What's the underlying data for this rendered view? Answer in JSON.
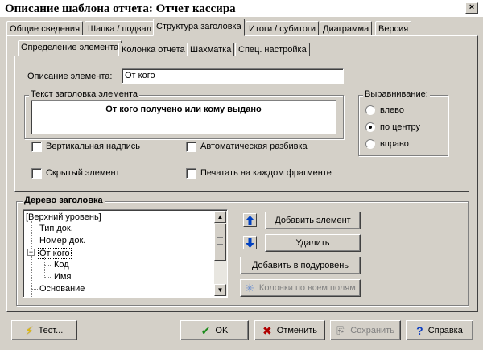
{
  "window": {
    "title": "Описание шаблона отчета: Отчет кассира",
    "close_label": "×"
  },
  "tabs": [
    "Общие сведения",
    "Шапка / подвал",
    "Структура заголовка",
    "Итоги / субитоги",
    "Диаграмма",
    "Версия"
  ],
  "inner_tabs": [
    "Определение элемента",
    "Колонка отчета",
    "Шахматка",
    "Спец. настройка"
  ],
  "element": {
    "description_label": "Описание элемента:",
    "description_value": "От кого",
    "header_text_group": "Текст заголовка элемента",
    "header_text_value": "От кого получено или кому выдано",
    "vertical_label": "Вертикальная надпись",
    "autowrap_label": "Автоматическая разбивка",
    "hidden_label": "Скрытый элемент",
    "print_each_label": "Печатать на каждом фрагменте"
  },
  "alignment": {
    "title": "Выравнивание:",
    "options": [
      "влево",
      "по центру",
      "вправо"
    ],
    "selected": "по центру"
  },
  "tree": {
    "title": "Дерево заголовка",
    "items": [
      "[Верхний уровень]",
      "Тип док.",
      "Номер док.",
      "От кого",
      "Код",
      "Имя",
      "Основание"
    ]
  },
  "tree_buttons": {
    "add": "Добавить элемент",
    "delete": "Удалить",
    "add_sublevel": "Добавить в подуровень",
    "columns_all": "Колонки по всем полям"
  },
  "footer": {
    "test": "Тест...",
    "ok": "OK",
    "cancel": "Отменить",
    "save": "Сохранить",
    "help": "Справка"
  },
  "colors": {
    "ok_check": "#1a8a1a",
    "cancel_x": "#b00000",
    "arrow_blue": "#0040c0",
    "help_q": "#1040c0",
    "test_bolt": "#e8c000"
  }
}
